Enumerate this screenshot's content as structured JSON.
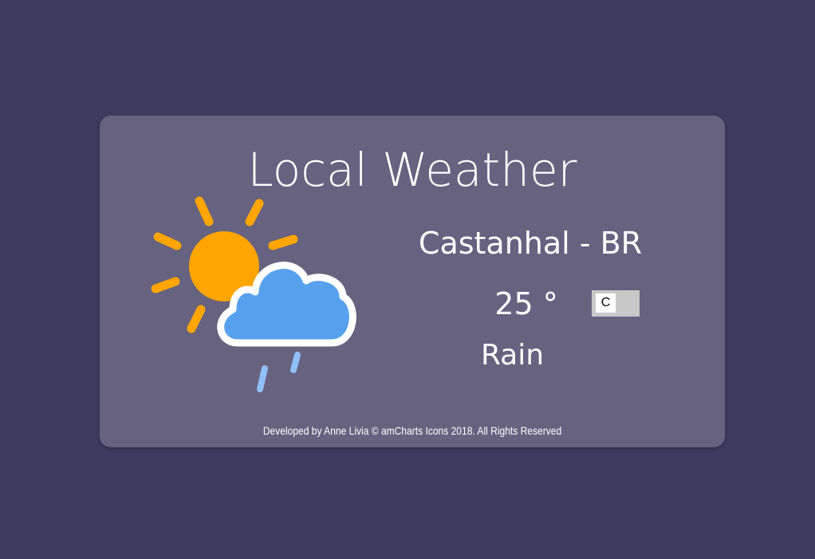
{
  "app": {
    "title": "Local Weather"
  },
  "weather": {
    "location": "Castanhal - BR",
    "temperature": "25 °",
    "unit": "C",
    "condition": "Rain",
    "icon": "sun-cloud-rain-icon"
  },
  "footer": {
    "credits": "Developed by Anne Livia © amCharts Icons 2018. All Rights Reserved"
  },
  "colors": {
    "background": "#3e3a5f",
    "card": "#66627f",
    "sun": "#ffa500",
    "cloud": "#57a0ee",
    "rain": "#91c0f8",
    "toggle": "#c8c8c8"
  }
}
